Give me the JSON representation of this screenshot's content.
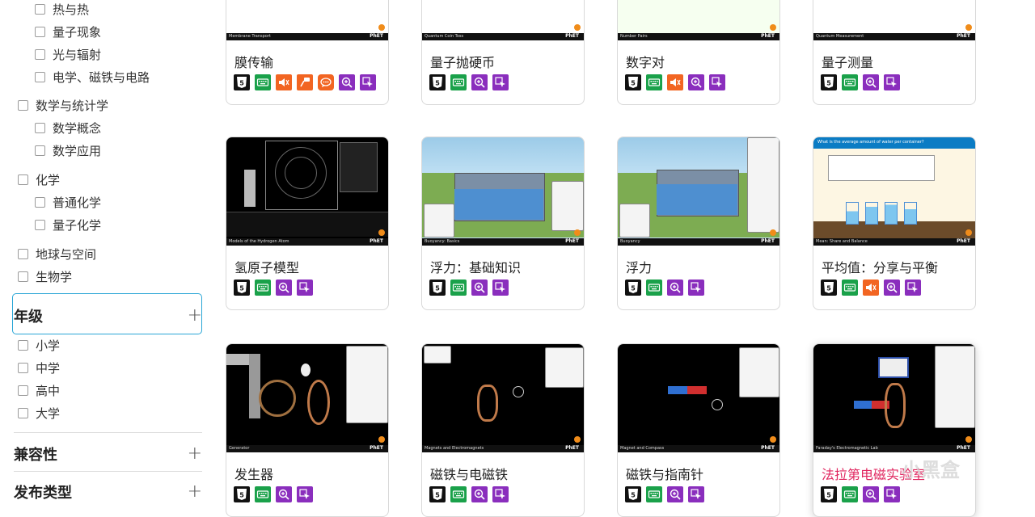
{
  "sidebar": {
    "physics_subitems": [
      {
        "label": "热与热"
      },
      {
        "label": "量子现象"
      },
      {
        "label": "光与辐射"
      },
      {
        "label": "电学、磁铁与电路"
      }
    ],
    "math": {
      "label": "数学与统计学",
      "subitems": [
        {
          "label": "数学概念"
        },
        {
          "label": "数学应用"
        }
      ]
    },
    "chemistry": {
      "label": "化学",
      "subitems": [
        {
          "label": "普通化学"
        },
        {
          "label": "量子化学"
        }
      ]
    },
    "earth": {
      "label": "地球与空间"
    },
    "biology": {
      "label": "生物学"
    },
    "grade": {
      "title": "年级",
      "items": [
        {
          "label": "小学"
        },
        {
          "label": "中学"
        },
        {
          "label": "高中"
        },
        {
          "label": "大学"
        }
      ]
    },
    "compat": {
      "title": "兼容性"
    },
    "release": {
      "title": "发布类型"
    },
    "plus_symbol": "+"
  },
  "cards": [
    {
      "title": "膜传输",
      "sim_label": "Membrane Transport",
      "features": [
        "html5",
        "keyboard",
        "sound",
        "description",
        "chat",
        "zoom",
        "pointer"
      ]
    },
    {
      "title": "量子抛硬币",
      "sim_label": "Quantum Coin Toss",
      "features": [
        "html5",
        "keyboard",
        "zoom",
        "pointer"
      ]
    },
    {
      "title": "数字对",
      "sim_label": "Number Pairs",
      "features": [
        "html5",
        "keyboard",
        "sound",
        "zoom",
        "pointer"
      ]
    },
    {
      "title": "量子测量",
      "sim_label": "Quantum Measurement",
      "features": [
        "html5",
        "keyboard",
        "zoom",
        "pointer"
      ]
    },
    {
      "title": "氢原子模型",
      "sim_label": "Models of the Hydrogen Atom",
      "features": [
        "html5",
        "keyboard",
        "zoom",
        "pointer"
      ]
    },
    {
      "title": "浮力：基础知识",
      "sim_label": "Buoyancy: Basics",
      "features": [
        "html5",
        "keyboard",
        "zoom",
        "pointer"
      ]
    },
    {
      "title": "浮力",
      "sim_label": "Buoyancy",
      "features": [
        "html5",
        "keyboard",
        "zoom",
        "pointer"
      ]
    },
    {
      "title": "平均值：分享与平衡",
      "sim_label": "Mean: Share and Balance",
      "thumb_question": "What is the average amount of water per container?",
      "features": [
        "html5",
        "keyboard",
        "sound",
        "zoom",
        "pointer"
      ]
    },
    {
      "title": "发生器",
      "sim_label": "Generator",
      "features": [
        "html5",
        "keyboard",
        "zoom",
        "pointer"
      ]
    },
    {
      "title": "磁铁与电磁铁",
      "sim_label": "Magnets and Electromagnets",
      "features": [
        "html5",
        "keyboard",
        "zoom",
        "pointer"
      ]
    },
    {
      "title": "磁铁与指南针",
      "sim_label": "Magnet and Compass",
      "features": [
        "html5",
        "keyboard",
        "zoom",
        "pointer"
      ]
    },
    {
      "title": "法拉第电磁实验室",
      "sim_label": "Faraday's Electromagnetic Lab",
      "features": [
        "html5",
        "keyboard",
        "zoom",
        "pointer"
      ]
    }
  ],
  "phet_logo": "PhET",
  "watermark": "小黑盒",
  "colors": {
    "accent": "#2aa6d6",
    "keyboard": "#1aa14a",
    "sound": "#f26522",
    "zoom": "#8a2ebd",
    "hover_title": "#e0245e"
  }
}
